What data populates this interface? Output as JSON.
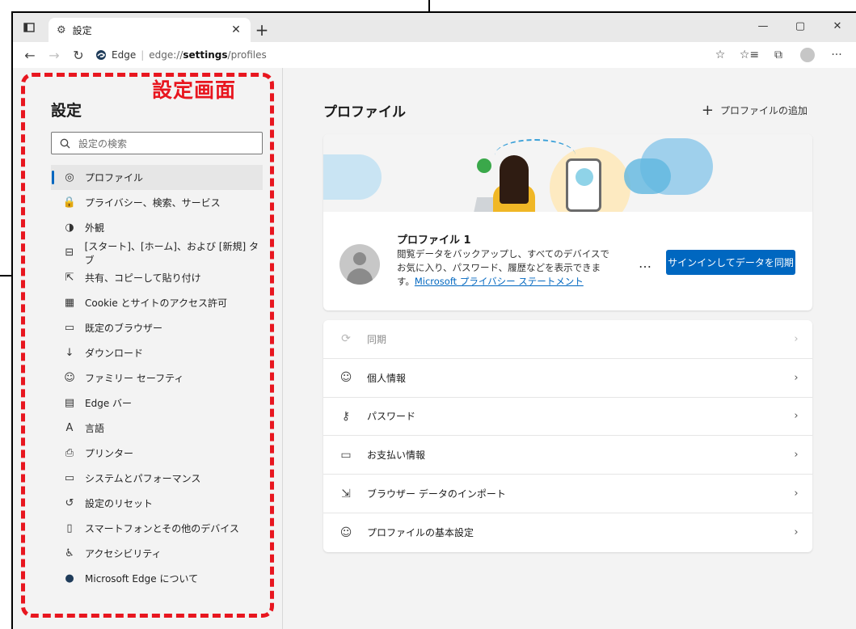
{
  "browser": {
    "tab_title": "設定",
    "address": {
      "edge_label": "Edge",
      "url_prefix": "edge://",
      "url_bold": "settings",
      "url_suffix": "/profiles"
    }
  },
  "annotation": {
    "label": "設定画面",
    "color": "#e8161f"
  },
  "sidebar": {
    "title": "設定",
    "search_placeholder": "設定の検索",
    "items": [
      {
        "label": "プロファイル",
        "icon": "profile-icon",
        "active": true
      },
      {
        "label": "プライバシー、検索、サービス",
        "icon": "lock-icon"
      },
      {
        "label": "外観",
        "icon": "appearance-icon"
      },
      {
        "label": "[スタート]、[ホーム]、および [新規] タブ",
        "icon": "tabs-icon"
      },
      {
        "label": "共有、コピーして貼り付け",
        "icon": "share-icon"
      },
      {
        "label": "Cookie とサイトのアクセス許可",
        "icon": "cookie-icon"
      },
      {
        "label": "既定のブラウザー",
        "icon": "browser-icon"
      },
      {
        "label": "ダウンロード",
        "icon": "download-icon"
      },
      {
        "label": "ファミリー セーフティ",
        "icon": "family-icon"
      },
      {
        "label": "Edge バー",
        "icon": "edge-bar-icon"
      },
      {
        "label": "言語",
        "icon": "language-icon"
      },
      {
        "label": "プリンター",
        "icon": "printer-icon"
      },
      {
        "label": "システムとパフォーマンス",
        "icon": "laptop-icon"
      },
      {
        "label": "設定のリセット",
        "icon": "reset-icon"
      },
      {
        "label": "スマートフォンとその他のデバイス",
        "icon": "phone-icon"
      },
      {
        "label": "アクセシビリティ",
        "icon": "accessibility-icon"
      },
      {
        "label": "Microsoft Edge について",
        "icon": "edge-logo-icon"
      }
    ]
  },
  "main": {
    "title": "プロファイル",
    "add_profile": "プロファイルの追加",
    "profile": {
      "name": "プロファイル 1",
      "description": "閲覧データをバックアップし、すべてのデバイスでお気に入り、パスワード、履歴などを表示できます。",
      "link": "Microsoft プライバシー ステートメント",
      "more": "…",
      "sync_button": "サインインしてデータを同期"
    },
    "rows": [
      {
        "label": "同期",
        "icon": "sync-icon",
        "disabled": true
      },
      {
        "label": "個人情報",
        "icon": "personal-info-icon"
      },
      {
        "label": "パスワード",
        "icon": "key-icon"
      },
      {
        "label": "お支払い情報",
        "icon": "card-icon"
      },
      {
        "label": "ブラウザー データのインポート",
        "icon": "import-icon"
      },
      {
        "label": "プロファイルの基本設定",
        "icon": "profile-settings-icon"
      }
    ]
  },
  "colors": {
    "accent": "#0067c0",
    "annotation": "#e8161f"
  }
}
